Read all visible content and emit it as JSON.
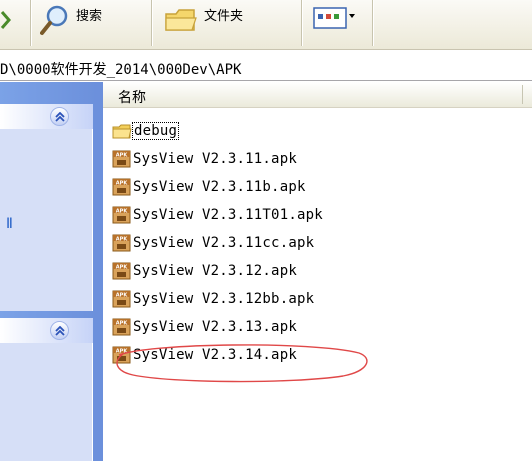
{
  "toolbar": {
    "search_label": "搜索",
    "folders_label": "文件夹"
  },
  "address": {
    "path": "D\\0000软件开发_2014\\000Dev\\APK"
  },
  "task_pane": {
    "fragment_text": "Ⅱ"
  },
  "file_list": {
    "column_name": "名称",
    "items": [
      {
        "name": "debug",
        "type": "folder"
      },
      {
        "name": "SysView V2.3.11.apk",
        "type": "apk"
      },
      {
        "name": "SysView V2.3.11b.apk",
        "type": "apk"
      },
      {
        "name": "SysView V2.3.11T01.apk",
        "type": "apk"
      },
      {
        "name": "SysView V2.3.11cc.apk",
        "type": "apk"
      },
      {
        "name": "SysView V2.3.12.apk",
        "type": "apk"
      },
      {
        "name": "SysView V2.3.12bb.apk",
        "type": "apk"
      },
      {
        "name": "SysView V2.3.13.apk",
        "type": "apk"
      },
      {
        "name": "SysView V2.3.14.apk",
        "type": "apk"
      }
    ]
  },
  "colors": {
    "annotation": "#e04848",
    "task_pane_blue": "#6b8fdb",
    "apk_icon": "#c87a28"
  }
}
